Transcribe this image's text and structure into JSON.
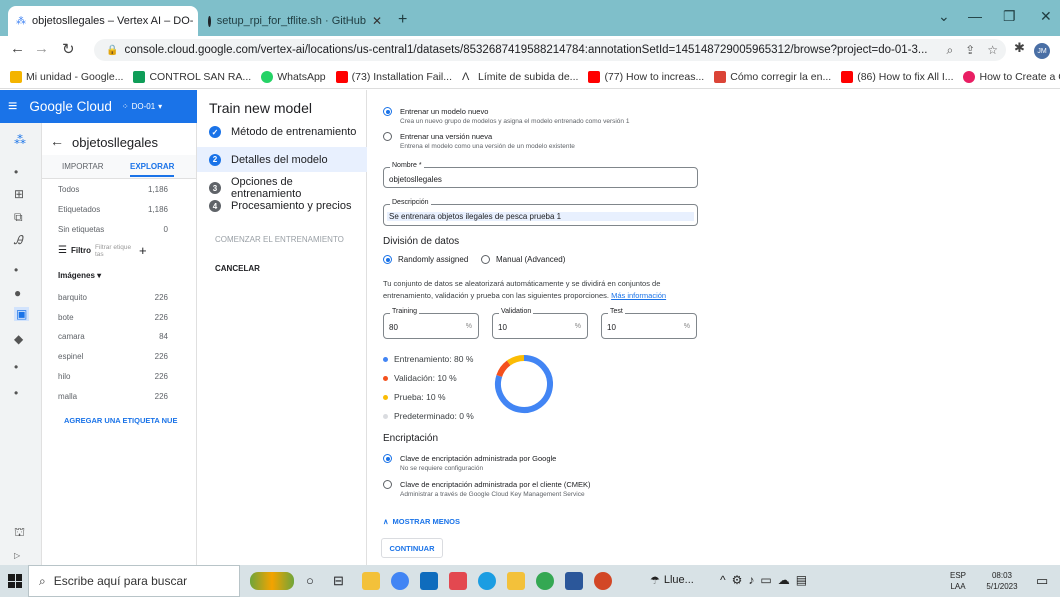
{
  "browser": {
    "tabs": [
      {
        "title": "objetosllegales – Vertex AI – DO-",
        "close": "✕"
      },
      {
        "title": "setup_rpi_for_tflite.sh · GitHub",
        "close": "✕"
      }
    ],
    "new_tab": "+",
    "url": "console.cloud.google.com/vertex-ai/locations/us-central1/datasets/8532687419588214784:annotationSetId=145148729005965312/browse?project=do-01-3...",
    "bookmarks": [
      {
        "label": "Mi unidad - Google...",
        "color": "#f4b400"
      },
      {
        "label": "CONTROL SAN RA...",
        "color": "#0f9d58"
      },
      {
        "label": "WhatsApp",
        "color": "#25d366"
      },
      {
        "label": "(73) Installation Fail...",
        "color": "#ff0000"
      },
      {
        "label": "Límite de subida de...",
        "color": "#333333"
      },
      {
        "label": "(77) How to increas...",
        "color": "#ff0000"
      },
      {
        "label": "Cómo corregir la en...",
        "color": "#db4437"
      },
      {
        "label": "(86) How to fix All I...",
        "color": "#ff0000"
      },
      {
        "label": "How to Create a CS...",
        "color": "#e91e63"
      }
    ],
    "bookmarks_more": "»"
  },
  "gcp": {
    "menu": "≡",
    "brand": "Google Cloud",
    "project": "DO-01",
    "dataset_title": "objetosllegales",
    "back": "←"
  },
  "dataset": {
    "tabs": [
      "IMPORTAR",
      "EXPLORAR"
    ],
    "stats": [
      {
        "label": "Todos",
        "count": "1,186"
      },
      {
        "label": "Etiquetados",
        "count": "1,186"
      },
      {
        "label": "Sin etiquetas",
        "count": "0"
      }
    ],
    "filter_label": "Filtro",
    "filter_placeholder": "Filtrar etique tas",
    "images_header": "Imágenes ▾",
    "labels": [
      {
        "label": "barquito",
        "count": "226"
      },
      {
        "label": "bote",
        "count": "226"
      },
      {
        "label": "camara",
        "count": "84"
      },
      {
        "label": "espinel",
        "count": "226"
      },
      {
        "label": "hilo",
        "count": "226"
      },
      {
        "label": "malla",
        "count": "226"
      }
    ],
    "add_label": "AGREGAR UNA ETIQUETA NUE"
  },
  "train": {
    "title": "Train new model",
    "steps": [
      {
        "label": "Método de entrenamiento",
        "mark": "✓",
        "color": "#1a73e8"
      },
      {
        "label": "Detalles del modelo",
        "mark": "2",
        "color": "#1a73e8"
      },
      {
        "label": "Opciones de entrenamiento",
        "mark": "3",
        "color": "#5f6368"
      },
      {
        "label": "Procesamiento y precios",
        "mark": "4",
        "color": "#5f6368"
      }
    ],
    "start": "COMENZAR EL ENTRENAMIENTO",
    "cancel": "CANCELAR"
  },
  "form": {
    "option_new": {
      "title": "Entrenar un modelo nuevo",
      "desc": "Crea un nuevo grupo de modelos y asigna el modelo entrenado como versión 1"
    },
    "option_version": {
      "title": "Entrenar una versión nueva",
      "desc": "Entrena el modelo como una versión de un modelo existente"
    },
    "name_label": "Nombre *",
    "name_value": "objetosllegales",
    "desc_label": "Descripción",
    "desc_value": "Se entrenara objetos ilegales de pesca prueba 1",
    "split_heading": "División de datos",
    "split_random": "Randomly assigned",
    "split_manual": "Manual (Advanced)",
    "split_text": "Tu conjunto de datos se aleatorizará automáticamente y se dividirá en conjuntos de entrenamiento, validación y prueba con las siguientes proporciones.",
    "split_link": "Más información",
    "training_label": "Training",
    "training_value": "80",
    "validation_label": "Validation",
    "validation_value": "10",
    "test_label": "Test",
    "test_value": "10",
    "pct": "%",
    "legend": [
      {
        "label": "Entrenamiento: 80 %",
        "color": "#4285f4",
        "value": 80
      },
      {
        "label": "Validación: 10 %",
        "color": "#f4511e",
        "value": 10
      },
      {
        "label": "Prueba: 10 %",
        "color": "#fbbc04",
        "value": 10
      },
      {
        "label": "Predeterminado: 0 %",
        "color": "#dadce0",
        "value": 0
      }
    ],
    "enc_heading": "Encriptación",
    "enc_google": {
      "title": "Clave de encriptación administrada por Google",
      "desc": "No se requiere configuración"
    },
    "enc_cmek": {
      "title": "Clave de encriptación administrada por el cliente (CMEK)",
      "desc": "Administrar a través de Google Cloud Key Management Service"
    },
    "show_less": "MOSTRAR MENOS",
    "continue": "CONTINUAR"
  },
  "taskbar": {
    "search_placeholder": "Escribe aquí para buscar",
    "weather": "Llue...",
    "lang": "ESP",
    "lang2": "LAA",
    "time": "08:03",
    "date": "5/1/2023"
  }
}
